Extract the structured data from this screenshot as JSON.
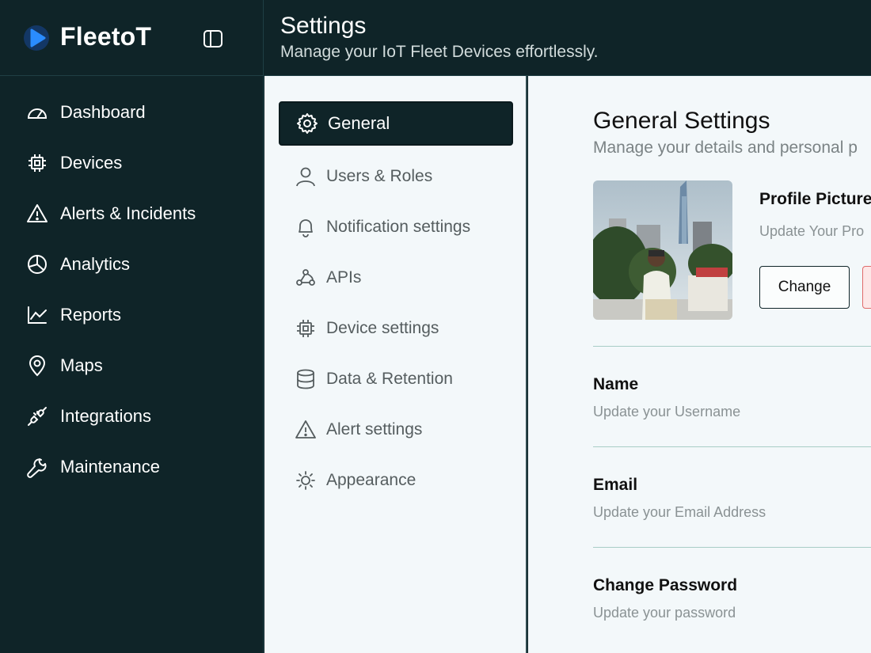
{
  "app": {
    "brand_name": "FleetoT",
    "colors": {
      "sidebar_bg": "#0f2428",
      "panel_bg": "#f3f8fa",
      "brand_accent": "#2a8cff",
      "divider": "#a8cdc6",
      "danger_border": "#e06b6b"
    }
  },
  "header": {
    "title": "Settings",
    "subtitle": "Manage your IoT Fleet Devices effortlessly."
  },
  "sidebar": {
    "items": [
      {
        "label": "Dashboard",
        "icon": "gauge-icon"
      },
      {
        "label": "Devices",
        "icon": "chip-icon"
      },
      {
        "label": "Alerts & Incidents",
        "icon": "warning-icon"
      },
      {
        "label": "Analytics",
        "icon": "pie-chart-icon"
      },
      {
        "label": "Reports",
        "icon": "line-chart-icon"
      },
      {
        "label": "Maps",
        "icon": "map-pin-icon"
      },
      {
        "label": "Integrations",
        "icon": "plug-icon"
      },
      {
        "label": "Maintenance",
        "icon": "wrench-icon"
      }
    ]
  },
  "settings_menu": {
    "items": [
      {
        "label": "General",
        "icon": "gear-icon",
        "active": true
      },
      {
        "label": "Users & Roles",
        "icon": "user-icon",
        "active": false
      },
      {
        "label": "Notification settings",
        "icon": "bell-icon",
        "active": false
      },
      {
        "label": "APIs",
        "icon": "webhook-icon",
        "active": false
      },
      {
        "label": "Device settings",
        "icon": "chip-icon",
        "active": false
      },
      {
        "label": "Data & Retention",
        "icon": "database-icon",
        "active": false
      },
      {
        "label": "Alert settings",
        "icon": "warning-icon",
        "active": false
      },
      {
        "label": "Appearance",
        "icon": "sun-icon",
        "active": false
      }
    ]
  },
  "general": {
    "title": "General Settings",
    "subtitle": "Manage your details and personal p",
    "profile_picture": {
      "title": "Profile Picture",
      "subtitle": "Update Your Pro",
      "change_label": "Change"
    },
    "fields": [
      {
        "title": "Name",
        "subtitle": "Update your Username"
      },
      {
        "title": "Email",
        "subtitle": "Update your Email Address"
      },
      {
        "title": "Change Password",
        "subtitle": "Update your password"
      }
    ]
  }
}
